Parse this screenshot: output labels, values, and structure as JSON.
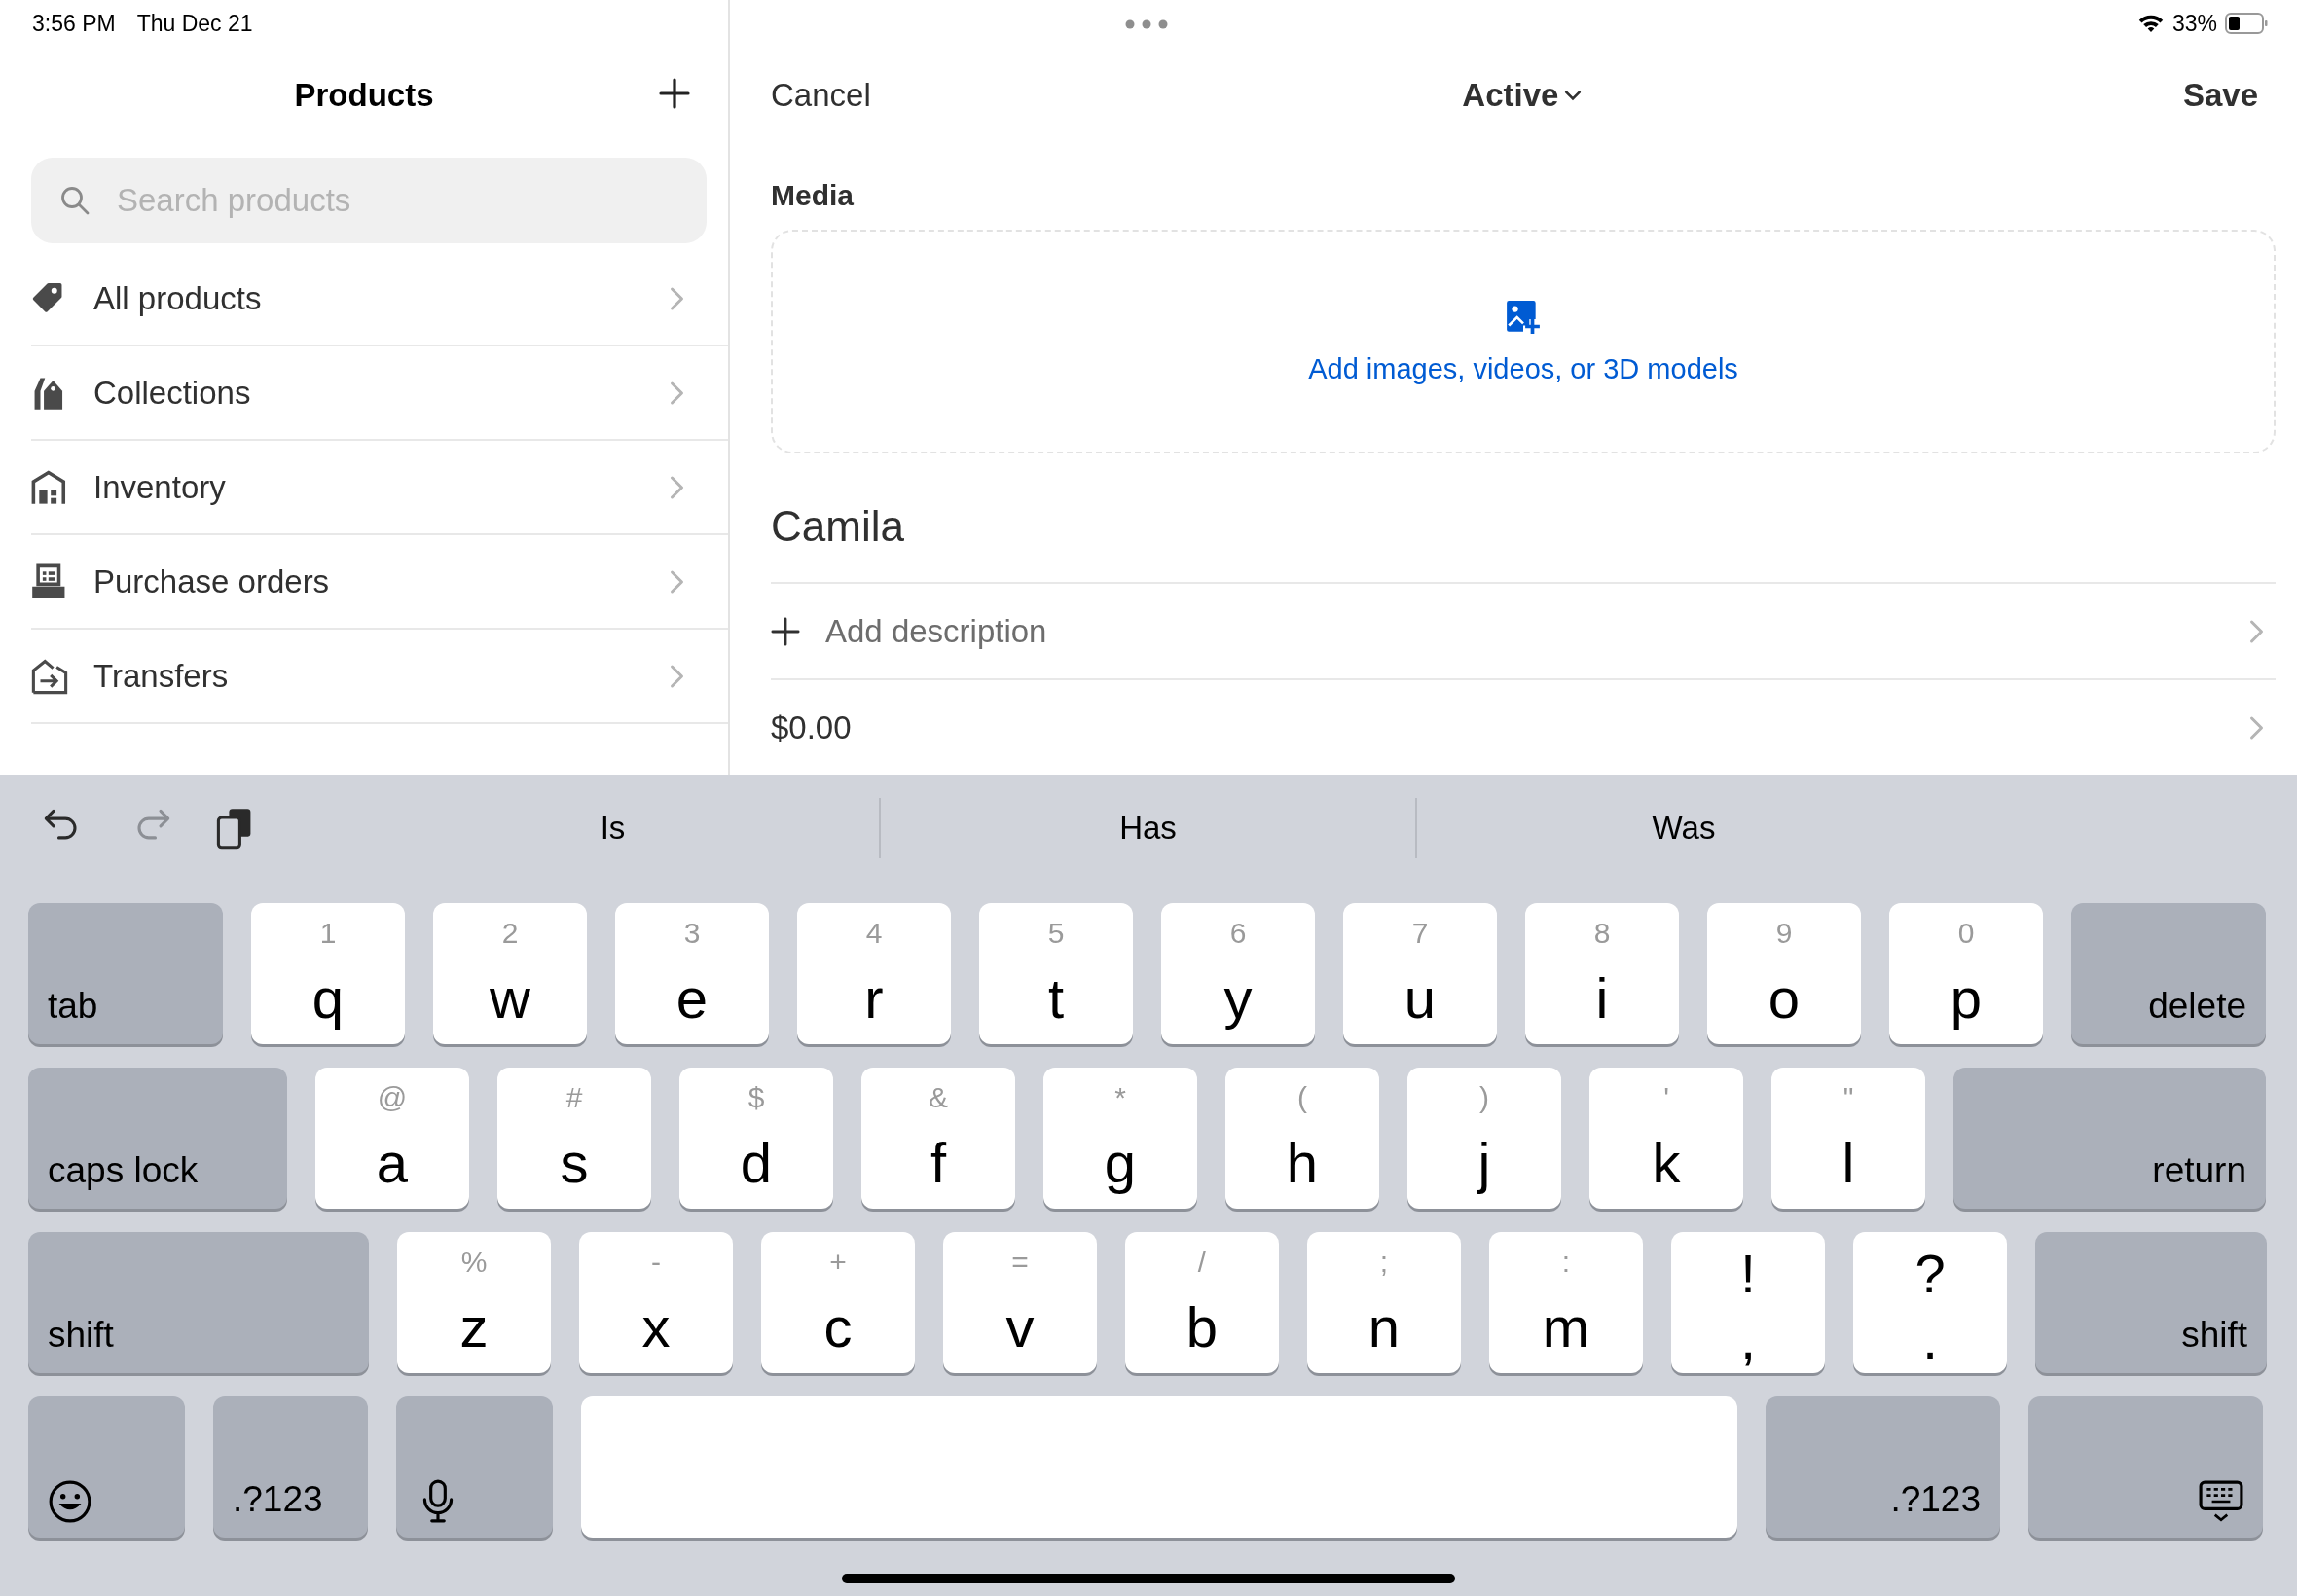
{
  "status_bar": {
    "time": "3:56 PM",
    "date": "Thu Dec 21",
    "battery": "33%"
  },
  "sidebar": {
    "title": "Products",
    "search": {
      "placeholder": "Search products"
    },
    "items": [
      {
        "label": "All products"
      },
      {
        "label": "Collections"
      },
      {
        "label": "Inventory"
      },
      {
        "label": "Purchase orders"
      },
      {
        "label": "Transfers"
      }
    ]
  },
  "editor": {
    "cancel": "Cancel",
    "status": "Active",
    "save": "Save",
    "media_label": "Media",
    "media_action": "Add images, videos, or 3D models",
    "title": "Camila",
    "description": {
      "placeholder": "Add description"
    },
    "price": "$0.00"
  },
  "keyboard": {
    "toolbar": [
      {
        "kind": "undo",
        "disabled": false
      },
      {
        "kind": "redo",
        "disabled": true
      },
      {
        "kind": "paste",
        "disabled": false
      }
    ],
    "suggestions": [
      "Is",
      "Has",
      "Was"
    ],
    "rows": [
      [
        {
          "kind": "special",
          "label": "tab"
        },
        {
          "kind": "letter",
          "label": "q",
          "hint": "1"
        },
        {
          "kind": "letter",
          "label": "w",
          "hint": "2"
        },
        {
          "kind": "letter",
          "label": "e",
          "hint": "3"
        },
        {
          "kind": "letter",
          "label": "r",
          "hint": "4"
        },
        {
          "kind": "letter",
          "label": "t",
          "hint": "5"
        },
        {
          "kind": "letter",
          "label": "y",
          "hint": "6"
        },
        {
          "kind": "letter",
          "label": "u",
          "hint": "7"
        },
        {
          "kind": "letter",
          "label": "i",
          "hint": "8"
        },
        {
          "kind": "letter",
          "label": "o",
          "hint": "9"
        },
        {
          "kind": "letter",
          "label": "p",
          "hint": "0"
        },
        {
          "kind": "special",
          "label": "delete"
        }
      ],
      [
        {
          "kind": "special",
          "label": "caps lock"
        },
        {
          "kind": "letter",
          "label": "a",
          "hint": "@"
        },
        {
          "kind": "letter",
          "label": "s",
          "hint": "#"
        },
        {
          "kind": "letter",
          "label": "d",
          "hint": "$"
        },
        {
          "kind": "letter",
          "label": "f",
          "hint": "&"
        },
        {
          "kind": "letter",
          "label": "g",
          "hint": "*"
        },
        {
          "kind": "letter",
          "label": "h",
          "hint": "("
        },
        {
          "kind": "letter",
          "label": "j",
          "hint": ")"
        },
        {
          "kind": "letter",
          "label": "k",
          "hint": "'"
        },
        {
          "kind": "letter",
          "label": "l",
          "hint": "\""
        },
        {
          "kind": "special",
          "label": "return"
        }
      ],
      [
        {
          "kind": "special",
          "label": "shift"
        },
        {
          "kind": "letter",
          "label": "z",
          "hint": "%"
        },
        {
          "kind": "letter",
          "label": "x",
          "hint": "-"
        },
        {
          "kind": "letter",
          "label": "c",
          "hint": "+"
        },
        {
          "kind": "letter",
          "label": "v",
          "hint": "="
        },
        {
          "kind": "letter",
          "label": "b",
          "hint": "/"
        },
        {
          "kind": "letter",
          "label": "n",
          "hint": ";"
        },
        {
          "kind": "letter",
          "label": "m",
          "hint": ":"
        },
        {
          "kind": "dual",
          "label": ",",
          "hint": "!"
        },
        {
          "kind": "dual",
          "label": ".",
          "hint": "?"
        },
        {
          "kind": "special",
          "label": "shift"
        }
      ],
      [
        {
          "kind": "emoji"
        },
        {
          "kind": "special",
          "label": ".?123"
        },
        {
          "kind": "mic"
        },
        {
          "kind": "space"
        },
        {
          "kind": "special",
          "label": ".?123"
        },
        {
          "kind": "hide"
        }
      ]
    ]
  }
}
